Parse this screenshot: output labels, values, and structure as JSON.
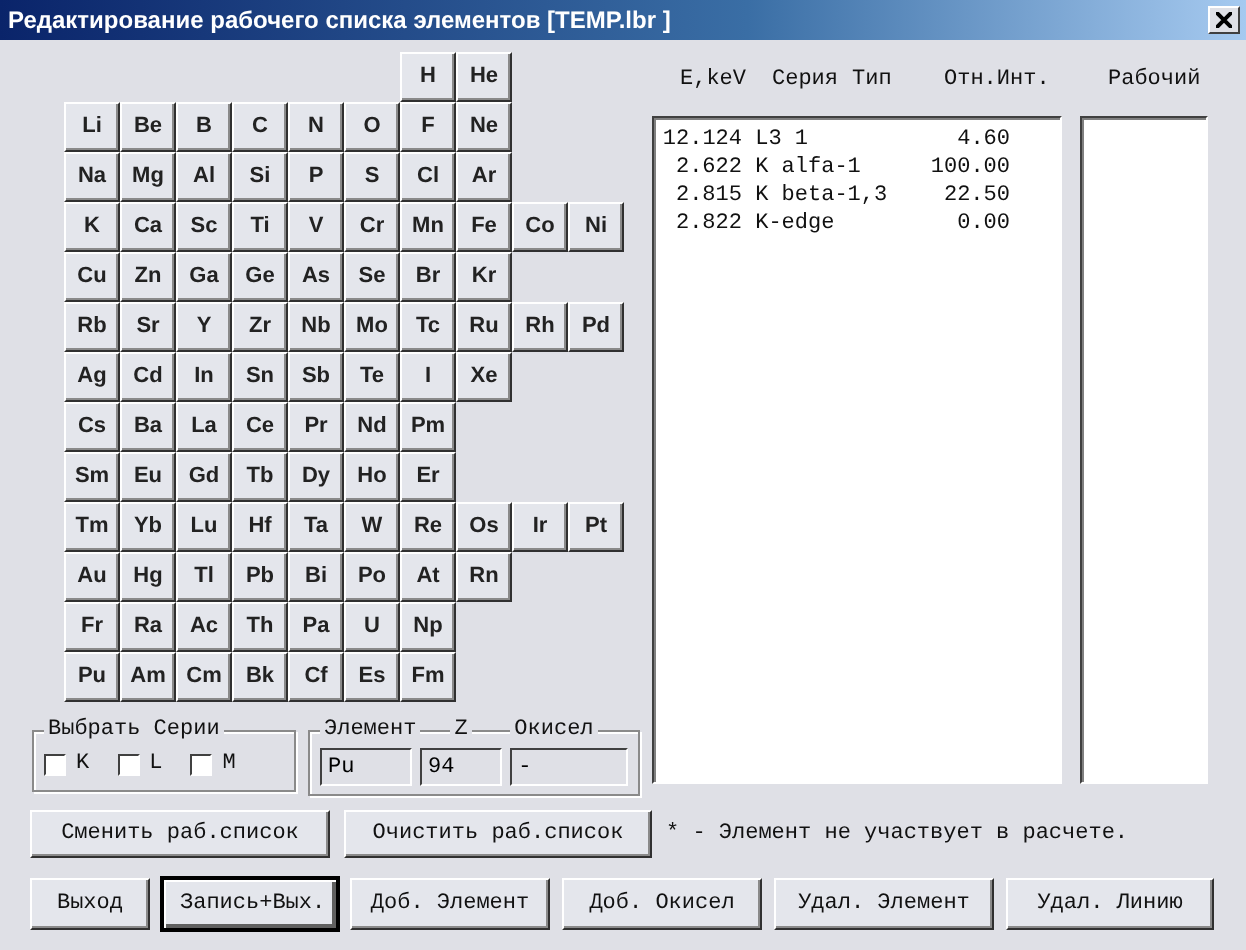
{
  "window": {
    "title": "Редактирование рабочего списка элементов [TEMP.lbr ]"
  },
  "periodic_table": {
    "top_row": [
      "H",
      "He"
    ],
    "rows": [
      [
        "Li",
        "Be",
        "B",
        "C",
        "N",
        "O",
        "F",
        "Ne"
      ],
      [
        "Na",
        "Mg",
        "Al",
        "Si",
        "P",
        "S",
        "Cl",
        "Ar"
      ],
      [
        "K",
        "Ca",
        "Sc",
        "Ti",
        "V",
        "Cr",
        "Mn",
        "Fe",
        "Co",
        "Ni"
      ],
      [
        "Cu",
        "Zn",
        "Ga",
        "Ge",
        "As",
        "Se",
        "Br",
        "Kr"
      ],
      [
        "Rb",
        "Sr",
        "Y",
        "Zr",
        "Nb",
        "Mo",
        "Tc",
        "Ru",
        "Rh",
        "Pd"
      ],
      [
        "Ag",
        "Cd",
        "In",
        "Sn",
        "Sb",
        "Te",
        "I",
        "Xe"
      ],
      [
        "Cs",
        "Ba",
        "La",
        "Ce",
        "Pr",
        "Nd",
        "Pm"
      ],
      [
        "Sm",
        "Eu",
        "Gd",
        "Tb",
        "Dy",
        "Ho",
        "Er"
      ],
      [
        "Tm",
        "Yb",
        "Lu",
        "Hf",
        "Ta",
        "W",
        "Re",
        "Os",
        "Ir",
        "Pt"
      ],
      [
        "Au",
        "Hg",
        "Tl",
        "Pb",
        "Bi",
        "Po",
        "At",
        "Rn"
      ],
      [
        "Fr",
        "Ra",
        "Ac",
        "Th",
        "Pa",
        "U",
        "Np"
      ],
      [
        "Pu",
        "Am",
        "Cm",
        "Bk",
        "Cf",
        "Es",
        "Fm"
      ]
    ]
  },
  "series_group": {
    "title": "Выбрать Серии",
    "options": [
      {
        "label": "K",
        "checked": false
      },
      {
        "label": "L",
        "checked": false
      },
      {
        "label": "M",
        "checked": false
      }
    ]
  },
  "element_group": {
    "fields": [
      {
        "label": "Элемент",
        "value": "Pu"
      },
      {
        "label": "Z",
        "value": "94"
      },
      {
        "label": "Окисел",
        "value": "-"
      }
    ]
  },
  "lines_header": {
    "energy": "E,keV",
    "series": "Серия",
    "type": "Тип",
    "intensity": "Отн.Инт.",
    "working": "Рабочий"
  },
  "lines": [
    {
      "energy": "12.124",
      "line": "L3 1",
      "intensity": "4.60"
    },
    {
      "energy": "2.622",
      "line": "K alfa-1",
      "intensity": "100.00"
    },
    {
      "energy": "2.815",
      "line": "K beta-1,3",
      "intensity": "22.50"
    },
    {
      "energy": "2.822",
      "line": "K-edge",
      "intensity": "0.00"
    }
  ],
  "list_buttons": [
    "Сменить раб.список",
    "Очистить раб.список"
  ],
  "note": "* - Элемент не участвует в расчете.",
  "buttons": [
    {
      "label": "Выход",
      "default": false
    },
    {
      "label": "Запись+Вых.",
      "default": true
    },
    {
      "label": "Доб. Элемент",
      "default": false
    },
    {
      "label": "Доб. Окисел",
      "default": false
    },
    {
      "label": "Удал. Элемент",
      "default": false
    },
    {
      "label": "Удал. Линию",
      "default": false
    }
  ]
}
